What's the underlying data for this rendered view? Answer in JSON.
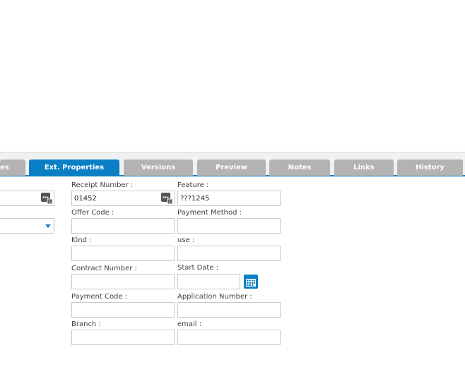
{
  "tabs": [
    {
      "label": "es",
      "active": false
    },
    {
      "label": "Ext. Properties",
      "active": true
    },
    {
      "label": "Versions",
      "active": false
    },
    {
      "label": "Preview",
      "active": false
    },
    {
      "label": "Notes",
      "active": false
    },
    {
      "label": "Links",
      "active": false
    },
    {
      "label": "History",
      "active": false
    }
  ],
  "fields": {
    "receipt_number": {
      "label": "Receipt Number :",
      "value": "01452"
    },
    "feature": {
      "label": "Feature :",
      "value": "???1245"
    },
    "offer_code": {
      "label": "Offer Code :",
      "value": ""
    },
    "payment_method": {
      "label": "Payment Method :",
      "value": ""
    },
    "kind": {
      "label": "Kind :",
      "value": ""
    },
    "use": {
      "label": "use :",
      "value": ""
    },
    "contract_number": {
      "label": "Contract Number :",
      "value": ""
    },
    "start_date": {
      "label": "Start Date :",
      "value": ""
    },
    "payment_code": {
      "label": "Payment Code :",
      "value": ""
    },
    "application_number": {
      "label": "Application Number :",
      "value": ""
    },
    "branch": {
      "label": "Branch :",
      "value": ""
    },
    "email": {
      "label": "email :",
      "value": ""
    }
  },
  "left_column": {
    "field_value": "",
    "dropdown_value": ""
  },
  "colors": {
    "accent": "#0a7fc5",
    "tab_inactive": "#b3b3b3",
    "input_border": "#c8c8c8",
    "label_text": "#444444"
  },
  "icons": {
    "picker": "list-picker-icon",
    "calendar": "calendar-icon",
    "dropdown": "chevron-down-icon"
  }
}
